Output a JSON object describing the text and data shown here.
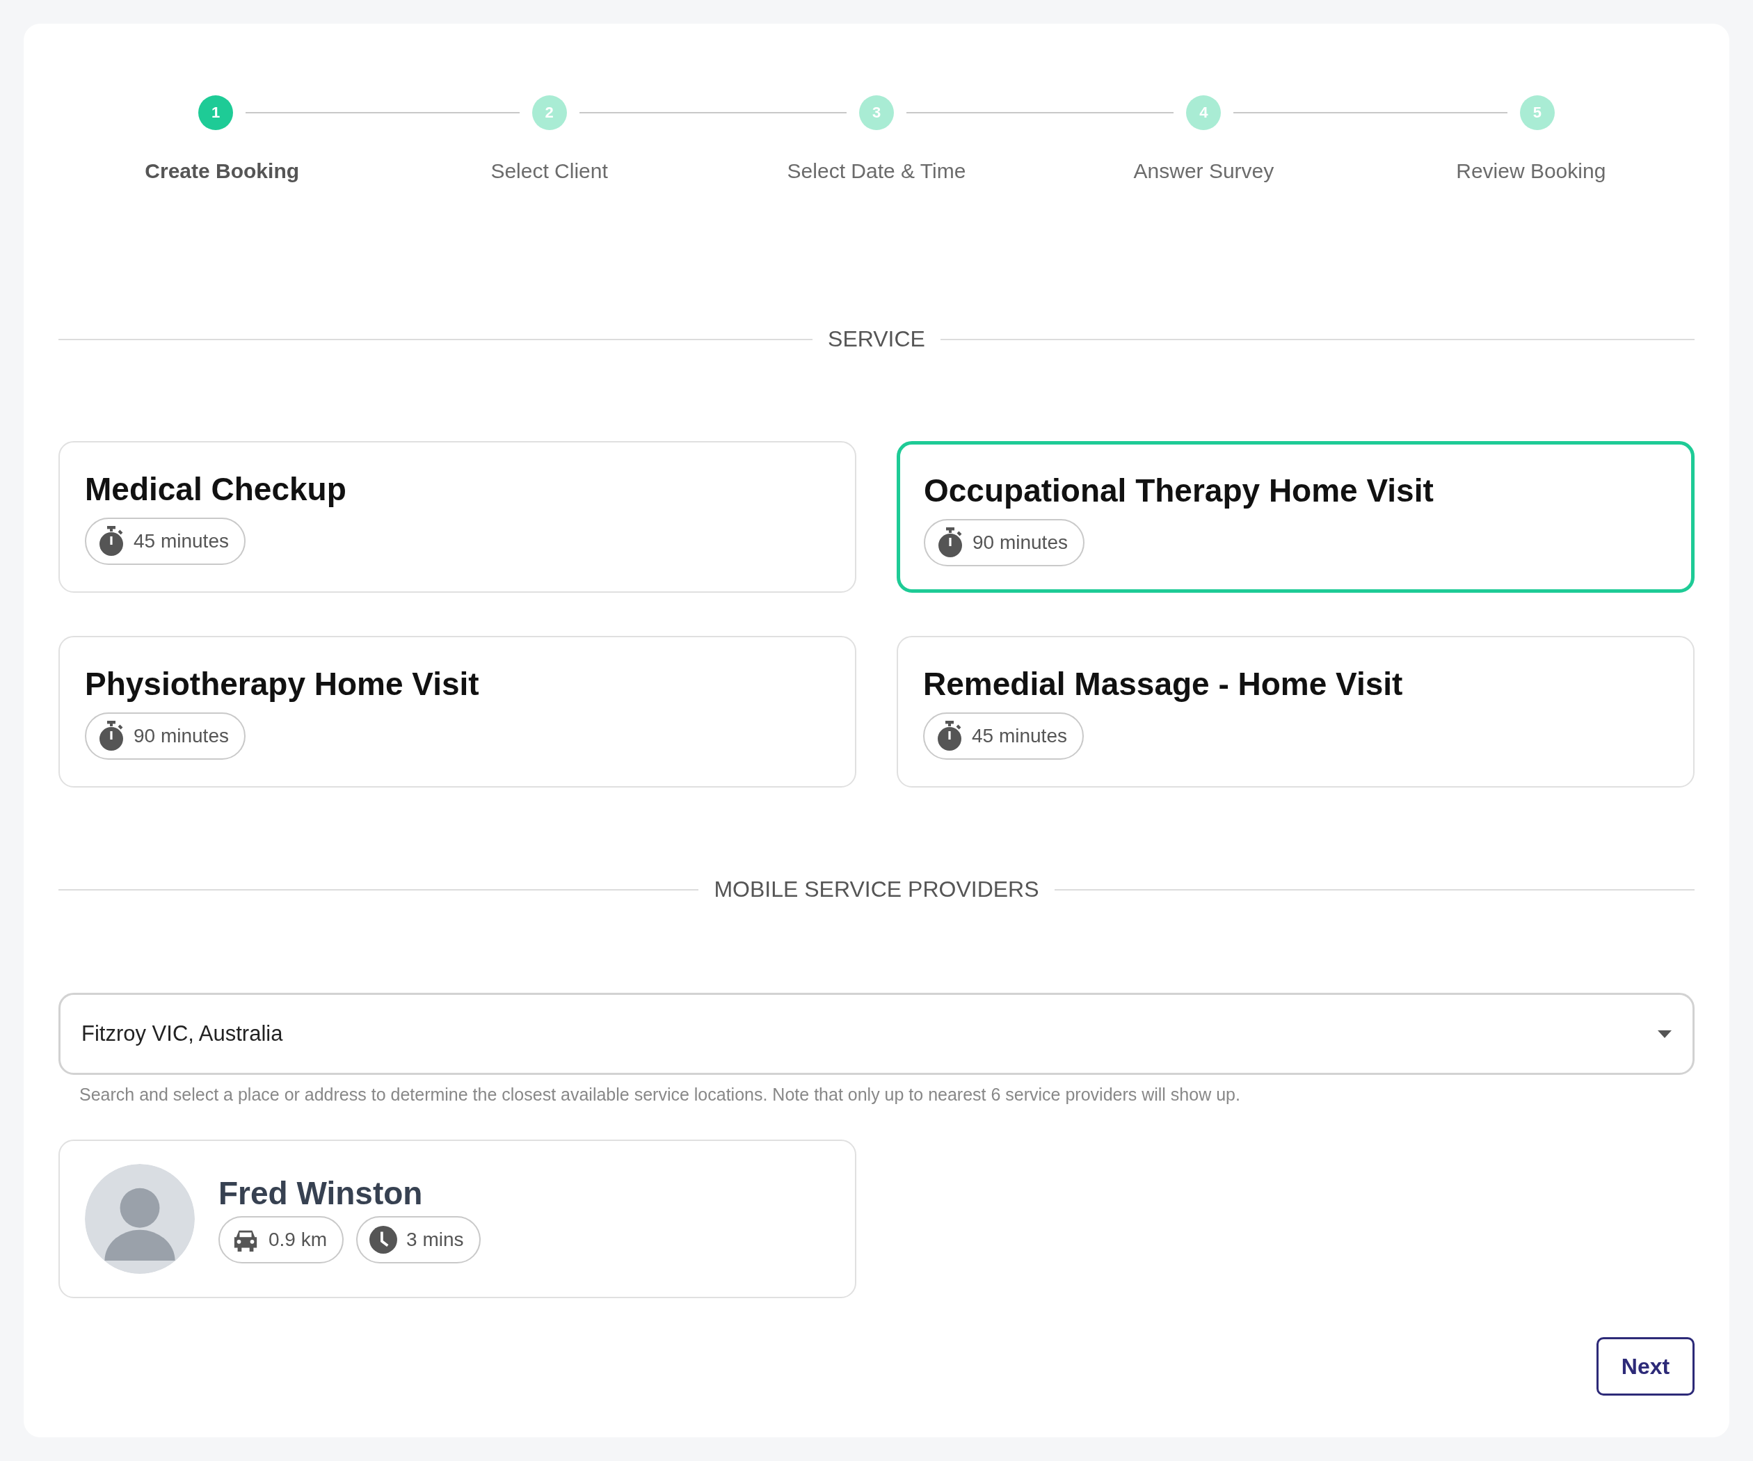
{
  "stepper": {
    "steps": [
      {
        "number": "1",
        "label": "Create Booking",
        "selected": true
      },
      {
        "number": "2",
        "label": "Select Client",
        "selected": false
      },
      {
        "number": "3",
        "label": "Select Date & Time",
        "selected": false
      },
      {
        "number": "4",
        "label": "Answer Survey",
        "selected": false
      },
      {
        "number": "5",
        "label": "Review Booking",
        "selected": false
      }
    ]
  },
  "service": {
    "heading": "SERVICE",
    "options": [
      {
        "name": "Medical Checkup",
        "duration": "45 minutes",
        "selected": false
      },
      {
        "name": "Occupational Therapy Home Visit",
        "duration": "90 minutes",
        "selected": true
      },
      {
        "name": "Physiotherapy Home Visit",
        "duration": "90 minutes",
        "selected": false
      },
      {
        "name": "Remedial Massage - Home Visit",
        "duration": "45 minutes",
        "selected": false
      }
    ]
  },
  "providers": {
    "heading": "MOBILE SERVICE PROVIDERS",
    "location": {
      "value": "Fitzroy VIC, Australia"
    },
    "helper": "Search and select a place or address to determine the closest available service locations. Note that only up to nearest 6 service providers will show up.",
    "items": [
      {
        "name": "Fred Winston",
        "distance": "0.9 km",
        "travel_time": "3 mins"
      }
    ]
  },
  "next_button": "Next"
}
